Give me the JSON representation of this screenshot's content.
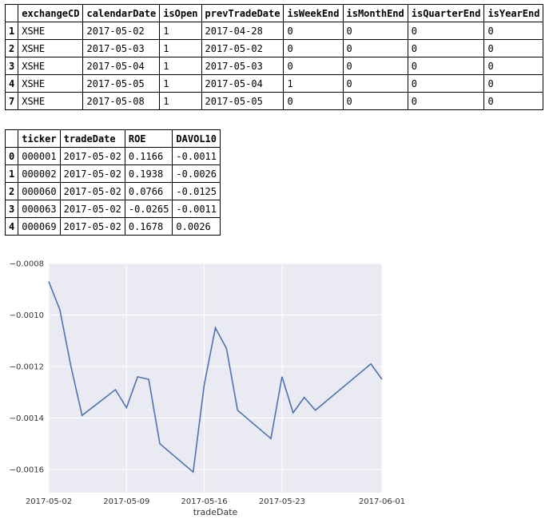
{
  "table1": {
    "columns": [
      "",
      "exchangeCD",
      "calendarDate",
      "isOpen",
      "prevTradeDate",
      "isWeekEnd",
      "isMonthEnd",
      "isQuarterEnd",
      "isYearEnd"
    ],
    "rows": [
      [
        "1",
        "XSHE",
        "2017-05-02",
        "1",
        "2017-04-28",
        "0",
        "0",
        "0",
        "0"
      ],
      [
        "2",
        "XSHE",
        "2017-05-03",
        "1",
        "2017-05-02",
        "0",
        "0",
        "0",
        "0"
      ],
      [
        "3",
        "XSHE",
        "2017-05-04",
        "1",
        "2017-05-03",
        "0",
        "0",
        "0",
        "0"
      ],
      [
        "4",
        "XSHE",
        "2017-05-05",
        "1",
        "2017-05-04",
        "1",
        "0",
        "0",
        "0"
      ],
      [
        "7",
        "XSHE",
        "2017-05-08",
        "1",
        "2017-05-05",
        "0",
        "0",
        "0",
        "0"
      ]
    ]
  },
  "table2": {
    "columns": [
      "",
      "ticker",
      "tradeDate",
      "ROE",
      "DAVOL10"
    ],
    "rows": [
      [
        "0",
        "000001",
        "2017-05-02",
        "0.1166",
        "-0.0011"
      ],
      [
        "1",
        "000002",
        "2017-05-02",
        "0.1938",
        "-0.0026"
      ],
      [
        "2",
        "000060",
        "2017-05-02",
        "0.0766",
        "-0.0125"
      ],
      [
        "3",
        "000063",
        "2017-05-02",
        "-0.0265",
        "-0.0011"
      ],
      [
        "4",
        "000069",
        "2017-05-02",
        "0.1678",
        "0.0026"
      ]
    ]
  },
  "chart_data": {
    "type": "line",
    "xlabel": "tradeDate",
    "ylabel": "",
    "grid": true,
    "background": "#eaeaf2",
    "line_color": "#4c72b0",
    "xlim": [
      "2017-05-02",
      "2017-06-01"
    ],
    "ylim": [
      -0.00169,
      -0.0008
    ],
    "xticks": [
      "2017-05-02",
      "2017-05-09",
      "2017-05-16",
      "2017-05-23",
      "2017-06-01"
    ],
    "yticks": [
      -0.0008,
      -0.001,
      -0.0012,
      -0.0014,
      -0.0016
    ],
    "ytick_labels": [
      "−0.0008",
      "−0.0010",
      "−0.0012",
      "−0.0014",
      "−0.0016"
    ],
    "x": [
      "2017-05-02",
      "2017-05-03",
      "2017-05-04",
      "2017-05-05",
      "2017-05-08",
      "2017-05-09",
      "2017-05-10",
      "2017-05-11",
      "2017-05-12",
      "2017-05-15",
      "2017-05-16",
      "2017-05-17",
      "2017-05-18",
      "2017-05-19",
      "2017-05-22",
      "2017-05-23",
      "2017-05-24",
      "2017-05-25",
      "2017-05-26",
      "2017-05-31",
      "2017-06-01"
    ],
    "values": [
      -0.00087,
      -0.00098,
      -0.0012,
      -0.00139,
      -0.00129,
      -0.00136,
      -0.00124,
      -0.00125,
      -0.0015,
      -0.00161,
      -0.00127,
      -0.00105,
      -0.00113,
      -0.00137,
      -0.00148,
      -0.00124,
      -0.00138,
      -0.00132,
      -0.00137,
      -0.00119,
      -0.00125
    ]
  }
}
